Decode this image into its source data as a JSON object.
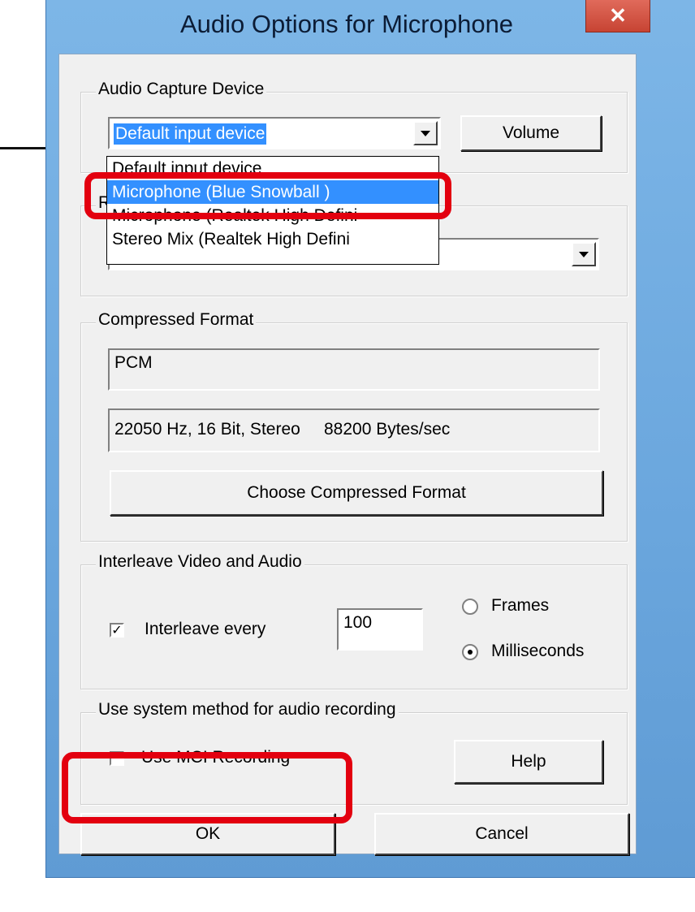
{
  "window": {
    "title": "Audio Options for Microphone",
    "close_glyph": "✕"
  },
  "capture": {
    "legend": "Audio Capture Device",
    "selected": "Default input device",
    "volume_label": "Volume",
    "options": [
      "Default input device",
      "Microphone (Blue Snowball )",
      "Microphone (Realtek High Defini",
      "Stereo Mix (Realtek High Defini"
    ],
    "highlighted_index": 1,
    "hidden_group_letter": "R"
  },
  "compressed": {
    "legend": "Compressed Format",
    "format": "PCM",
    "details": "22050 Hz, 16 Bit, Stereo     88200 Bytes/sec",
    "choose_label": "Choose  Compressed Format"
  },
  "interleave": {
    "legend": "Interleave Video and Audio",
    "checkbox_label": "Interleave every",
    "checked": true,
    "value": "100",
    "frames_label": "Frames",
    "ms_label": "Milliseconds",
    "selected_unit": "Milliseconds"
  },
  "system": {
    "legend": "Use system method for audio recording",
    "mci_label": "Use MCI Recording",
    "mci_checked": false,
    "help_label": "Help"
  },
  "buttons": {
    "ok": "OK",
    "cancel": "Cancel"
  },
  "colors": {
    "annotation": "#e3000f",
    "selection": "#3390ff",
    "frame": "#6aa6dd"
  }
}
